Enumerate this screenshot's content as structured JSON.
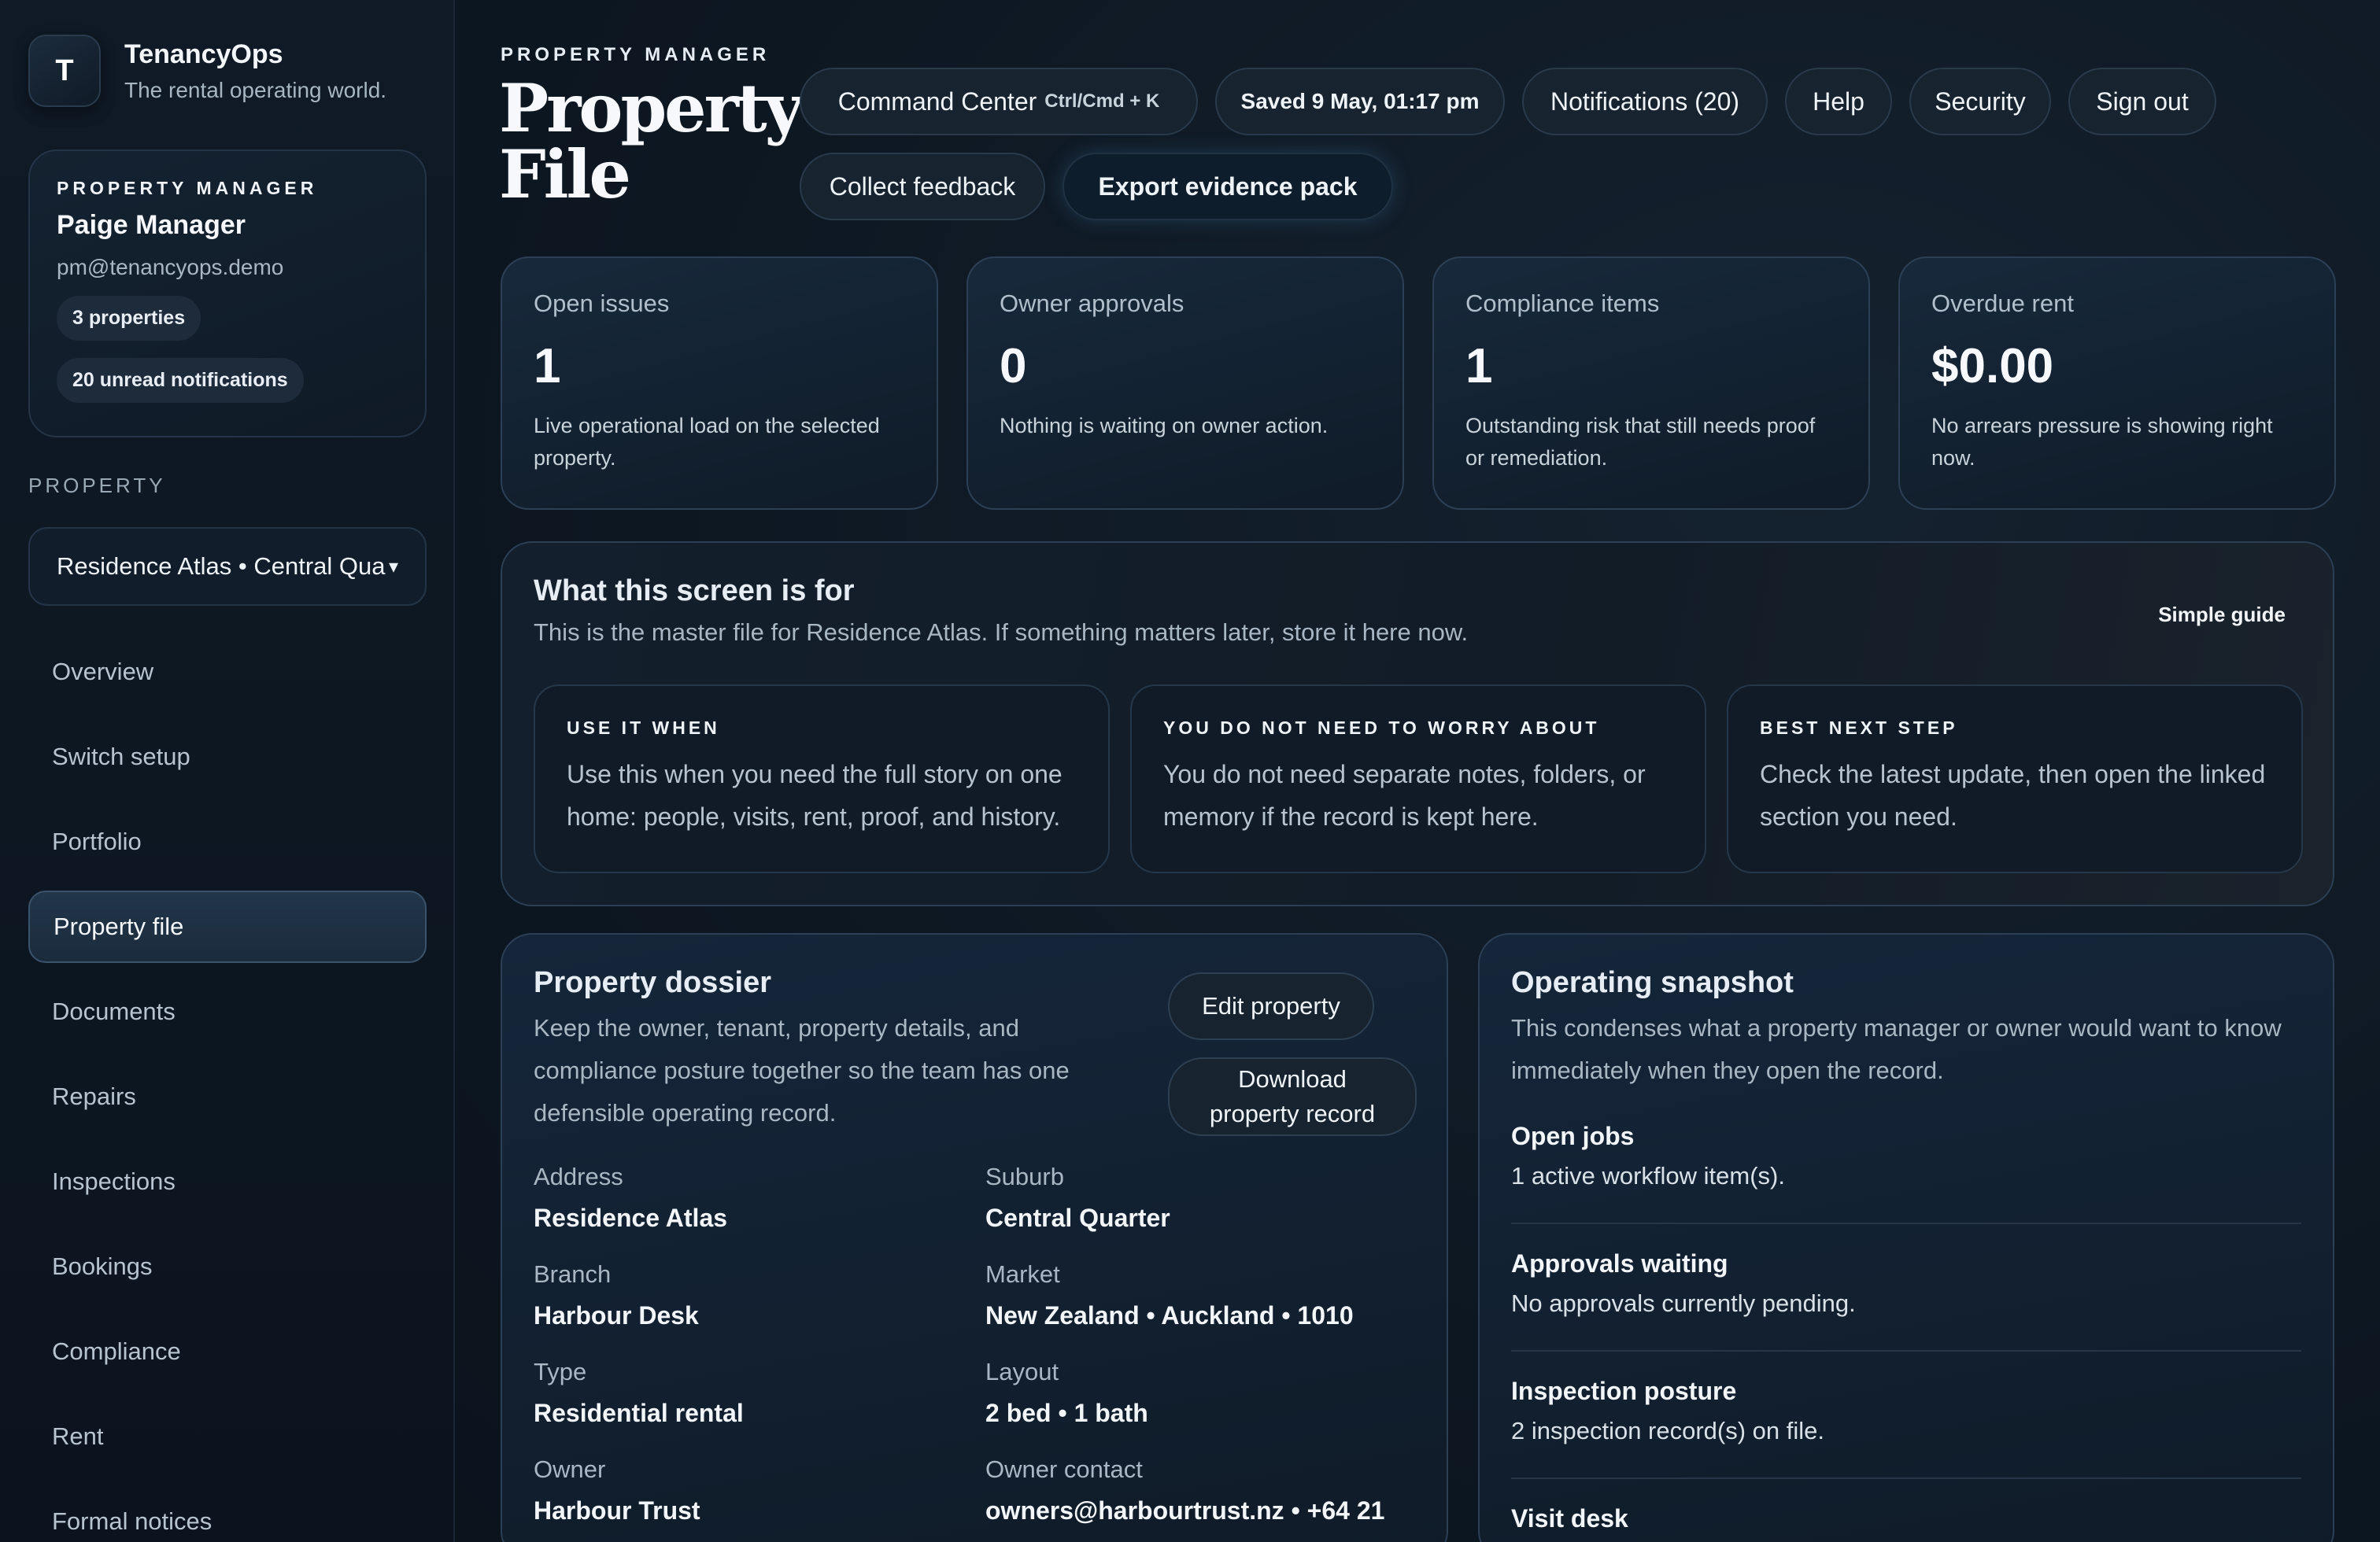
{
  "brand": {
    "logo_letter": "T",
    "name": "TenancyOps",
    "tagline": "The rental operating world."
  },
  "user": {
    "role": "Property Manager",
    "name": "Paige Manager",
    "email": "pm@tenancyops.demo",
    "properties_badge": "3 properties",
    "notifications_badge": "20 unread notifications"
  },
  "property_picker": {
    "label": "PROPERTY",
    "selected": "Residence Atlas • Central Quarter"
  },
  "nav": [
    {
      "label": "Overview",
      "active": false
    },
    {
      "label": "Switch setup",
      "active": false
    },
    {
      "label": "Portfolio",
      "active": false
    },
    {
      "label": "Property file",
      "active": true
    },
    {
      "label": "Documents",
      "active": false
    },
    {
      "label": "Repairs",
      "active": false
    },
    {
      "label": "Inspections",
      "active": false
    },
    {
      "label": "Bookings",
      "active": false
    },
    {
      "label": "Compliance",
      "active": false
    },
    {
      "label": "Rent",
      "active": false
    },
    {
      "label": "Formal notices",
      "active": false
    }
  ],
  "header": {
    "eyebrow": "PROPERTY MANAGER",
    "title": "Property File",
    "command_center": "Command Center",
    "command_shortcut": "Ctrl/Cmd + K",
    "saved": "Saved 9 May, 01:17 pm",
    "notifications": "Notifications (20)",
    "help": "Help",
    "security": "Security",
    "sign_out": "Sign out",
    "collect_feedback": "Collect feedback",
    "export": "Export evidence pack"
  },
  "stats": [
    {
      "label": "Open issues",
      "value": "1",
      "desc": "Live operational load on the selected property."
    },
    {
      "label": "Owner approvals",
      "value": "0",
      "desc": "Nothing is waiting on owner action."
    },
    {
      "label": "Compliance items",
      "value": "1",
      "desc": "Outstanding risk that still needs proof or remediation."
    },
    {
      "label": "Overdue rent",
      "value": "$0.00",
      "desc": "No arrears pressure is showing right now."
    }
  ],
  "guide": {
    "title": "What this screen is for",
    "subtitle": "This is the master file for Residence Atlas. If something matters later, store it here now.",
    "link": "Simple guide",
    "tips": [
      {
        "eyebrow": "Use it when",
        "text": "Use this when you need the full story on one home: people, visits, rent, proof, and history."
      },
      {
        "eyebrow": "You do not need to worry about",
        "text": "You do not need separate notes, folders, or memory if the record is kept here."
      },
      {
        "eyebrow": "Best next step",
        "text": "Check the latest update, then open the linked section you need."
      }
    ]
  },
  "dossier": {
    "title": "Property dossier",
    "desc": "Keep the owner, tenant, property details, and compliance posture together so the team has one defensible operating record.",
    "edit_button": "Edit property",
    "download_button": "Download property record",
    "fields": [
      {
        "label": "Address",
        "value": "Residence Atlas"
      },
      {
        "label": "Suburb",
        "value": "Central Quarter"
      },
      {
        "label": "Branch",
        "value": "Harbour Desk"
      },
      {
        "label": "Market",
        "value": "New Zealand • Auckland • 1010"
      },
      {
        "label": "Type",
        "value": "Residential rental"
      },
      {
        "label": "Layout",
        "value": "2 bed • 1 bath"
      },
      {
        "label": "Owner",
        "value": "Harbour Trust"
      },
      {
        "label": "Owner contact",
        "value": "owners@harbourtrust.nz • +64 21"
      }
    ]
  },
  "snapshot": {
    "title": "Operating snapshot",
    "desc": "This condenses what a property manager or owner would want to know immediately when they open the record.",
    "items": [
      {
        "title": "Open jobs",
        "desc": "1 active workflow item(s)."
      },
      {
        "title": "Approvals waiting",
        "desc": "No approvals currently pending."
      },
      {
        "title": "Inspection posture",
        "desc": "2 inspection record(s) on file."
      },
      {
        "title": "Visit desk",
        "desc": ""
      }
    ]
  }
}
